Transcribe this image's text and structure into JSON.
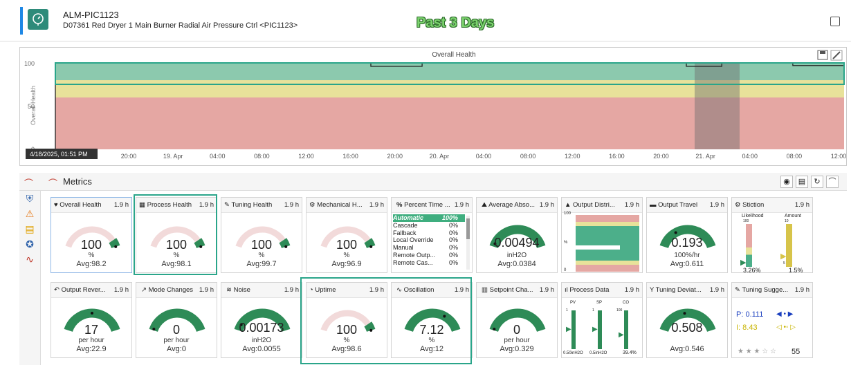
{
  "header": {
    "title": "ALM-PIC1123",
    "subtitle": "D07361 Red Dryer 1 Main Burner Radial Air Pressure Ctrl <PIC1123>",
    "overlay": "Past 3 Days"
  },
  "chart": {
    "title": "Overall Health",
    "ylabel": "Overall Health",
    "yticks": [
      "100",
      "50",
      "0"
    ],
    "tooltip": "4/18/2025, 01:51 PM",
    "xticks": [
      "20:00",
      "19. Apr",
      "04:00",
      "08:00",
      "12:00",
      "16:00",
      "20:00",
      "20. Apr",
      "04:00",
      "08:00",
      "12:00",
      "16:00",
      "20:00",
      "21. Apr",
      "04:00",
      "08:00",
      "12:00"
    ]
  },
  "chart_data": {
    "type": "line",
    "title": "Overall Health",
    "ylabel": "Overall Health",
    "ylim": [
      0,
      100
    ],
    "bands": [
      {
        "from": 80,
        "to": 100,
        "color": "#8cc9ae"
      },
      {
        "from": 60,
        "to": 80,
        "color": "#e8e29a"
      },
      {
        "from": 0,
        "to": 60,
        "color": "#e5a7a3"
      }
    ],
    "series": [
      {
        "x": [
          0,
          0.4,
          0.4,
          0.465,
          0.465,
          0.8,
          0.8,
          0.845,
          0.845,
          0.935,
          0.935,
          1
        ],
        "values": [
          100,
          100,
          96,
          96,
          100,
          100,
          96,
          96,
          100,
          100,
          97,
          97
        ]
      }
    ]
  },
  "metrics": {
    "title": "Metrics",
    "row1": [
      {
        "title": "Overall Health",
        "time": "1.9 h",
        "value": "100",
        "unit": "%",
        "avg": "Avg:98.2"
      },
      {
        "title": "Process Health",
        "time": "1.9 h",
        "value": "100",
        "unit": "%",
        "avg": "Avg:98.1"
      },
      {
        "title": "Tuning Health",
        "time": "1.9 h",
        "value": "100",
        "unit": "%",
        "avg": "Avg:99.7"
      },
      {
        "title": "Mechanical H...",
        "time": "1.9 h",
        "value": "100",
        "unit": "%",
        "avg": "Avg:96.9"
      },
      {
        "title": "Percent Time ...",
        "time": "1.9 h"
      },
      {
        "title": "Average Abso...",
        "time": "1.9 h",
        "value": "0.00494",
        "unit": "inH2O",
        "avg": "Avg:0.0384"
      },
      {
        "title": "Output Distri...",
        "time": "1.9 h",
        "ytop": "100",
        "ymid": "%",
        "ybot": "0"
      },
      {
        "title": "Output Travel",
        "time": "1.9 h",
        "value": "0.193",
        "unit": "100%/hr",
        "avg": "Avg:0.611"
      },
      {
        "title": "Stiction",
        "time": "1.9 h",
        "l1": "Likelihood",
        "l2": "Amount",
        "s1": "100",
        "s2": "10",
        "s3": "5",
        "v1": "3.26%",
        "v2": "1.5%"
      }
    ],
    "percent_time": [
      {
        "label": "Automatic",
        "value": "100%"
      },
      {
        "label": "Cascade",
        "value": "0%"
      },
      {
        "label": "Fallback",
        "value": "0%"
      },
      {
        "label": "Local Override",
        "value": "0%"
      },
      {
        "label": "Manual",
        "value": "0%"
      },
      {
        "label": "Remote Outp...",
        "value": "0%"
      },
      {
        "label": "Remote Cas...",
        "value": "0%"
      }
    ],
    "row2": [
      {
        "title": "Output Rever...",
        "time": "1.9 h",
        "value": "17",
        "unit": "per hour",
        "avg": "Avg:22.9"
      },
      {
        "title": "Mode Changes",
        "time": "1.9 h",
        "value": "0",
        "unit": "per hour",
        "avg": "Avg:0"
      },
      {
        "title": "Noise",
        "time": "1.9 h",
        "value": "0.00173",
        "unit": "inH2O",
        "avg": "Avg:0.0055"
      },
      {
        "title": "Uptime",
        "time": "1.9 h",
        "value": "100",
        "unit": "%",
        "avg": "Avg:98.6"
      },
      {
        "title": "Oscillation",
        "time": "1.9 h",
        "value": "7.12",
        "unit": "%",
        "avg": "Avg:12"
      },
      {
        "title": "Setpoint Cha...",
        "time": "1.9 h",
        "value": "0",
        "unit": "per hour",
        "avg": "Avg:0.329"
      },
      {
        "title": "Process Data",
        "time": "1.9 h",
        "pv": "PV",
        "sp": "SP",
        "co": "CO",
        "b1": "0.50inH2O",
        "b2": "0.5inH2O",
        "b3": "39.4%",
        "t1": "1",
        "t2": "1",
        "t3": "100"
      },
      {
        "title": "Tuning Deviat...",
        "time": "1.9 h",
        "value": "0.508",
        "avg": "Avg:0.546"
      },
      {
        "title": "Tuning Sugge...",
        "time": "1.9 h",
        "p": "P: 0.111",
        "i": "I: 8.43",
        "stars": "★ ★ ★ ☆ ☆",
        "count": "55"
      }
    ]
  }
}
